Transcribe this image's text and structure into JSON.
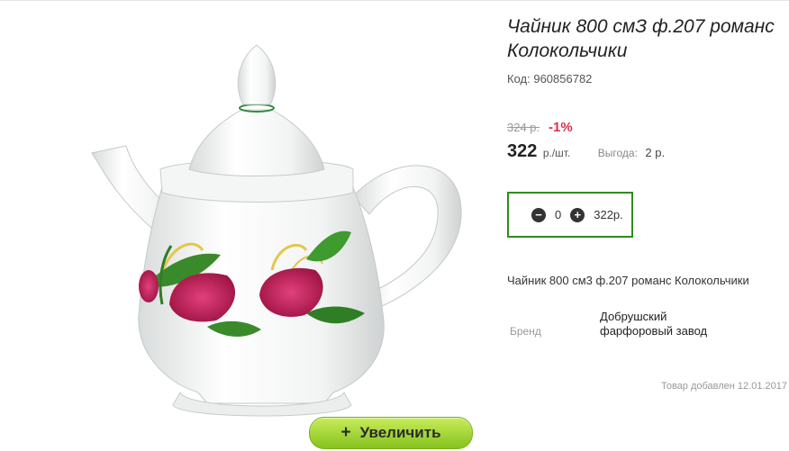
{
  "product": {
    "title": "Чайник 800 смЗ ф.207 романс Колокольчики",
    "code_label": "Код:",
    "code_value": "960856782",
    "description": "Чайник 800 см3 ф.207 романс Колокольчики",
    "brand_label": "Бренд",
    "brand_value": "Добрушский фарфоровый завод",
    "added_text": "Товар добавлен 12.01.2017"
  },
  "pricing": {
    "old_price": "324 р.",
    "discount": "-1%",
    "price": "322",
    "unit": "р./шт.",
    "benefit_label": "Выгода:",
    "benefit_value": "2 р."
  },
  "quantity": {
    "value": "0",
    "total": "322р.",
    "minus_icon": "minus-circle-icon",
    "plus_icon": "plus-circle-icon"
  },
  "zoom_button": {
    "icon": "+",
    "label": "Увеличить"
  },
  "colors": {
    "zoom_button": "#a6d93a",
    "discount": "#d9304f",
    "qty_border": "#2e8b1f"
  }
}
